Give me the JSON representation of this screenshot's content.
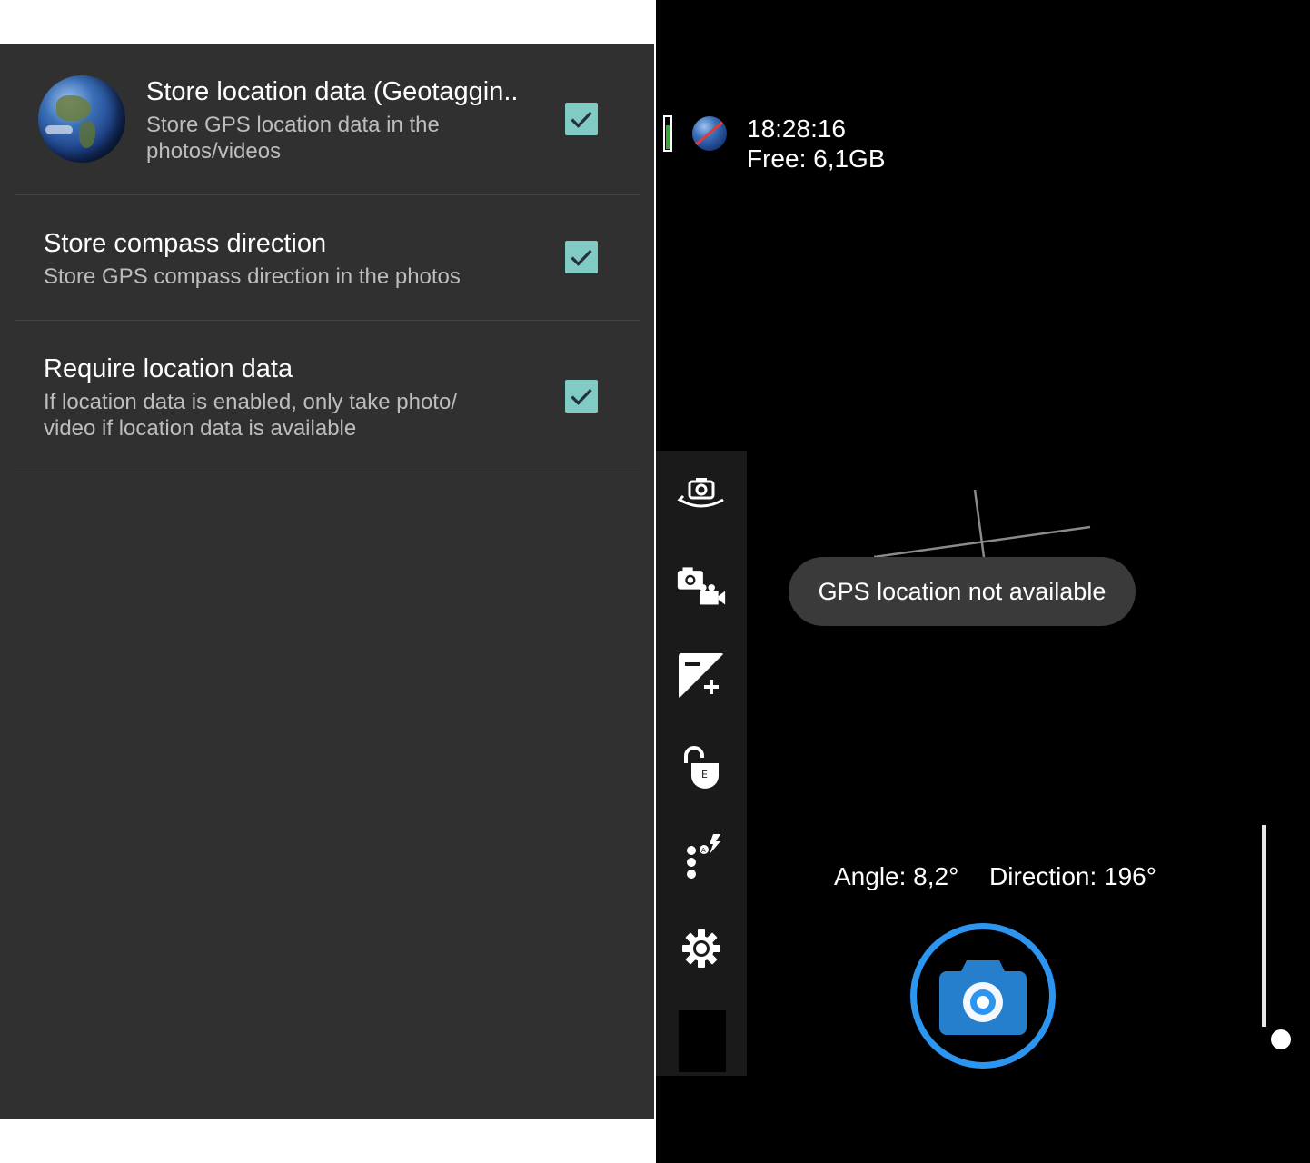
{
  "settings": {
    "prefs": [
      {
        "title": "Store location data (Geotaggin..",
        "summary": "Store GPS location data in the photos/videos",
        "checked": true,
        "icon": "earth-globe-icon"
      },
      {
        "title": "Store compass direction",
        "summary": "Store GPS compass direction in the photos",
        "checked": true
      },
      {
        "title": "Require location data",
        "summary": "If location data is enabled, only take photo/ video if location data is available",
        "checked": true
      }
    ],
    "accent_color": "#80cbc4",
    "background_color": "#303030"
  },
  "camera": {
    "status": {
      "time": "18:28:16",
      "free": "Free: 6,1GB",
      "battery_level": 0.7,
      "location_icon": "location-unavailable-globe-icon"
    },
    "toolbar": [
      {
        "name": "switch-camera-icon"
      },
      {
        "name": "photo-video-toggle-icon"
      },
      {
        "name": "exposure-compensation-icon"
      },
      {
        "name": "exposure-lock-icon"
      },
      {
        "name": "popup-menu-flash-auto-icon"
      },
      {
        "name": "settings-gear-icon"
      }
    ],
    "toast": "GPS location not available",
    "angle": "Angle: 8,2°",
    "direction": "Direction: 196°",
    "shutter_color": "#2b95f0",
    "zoom_level": 0
  }
}
